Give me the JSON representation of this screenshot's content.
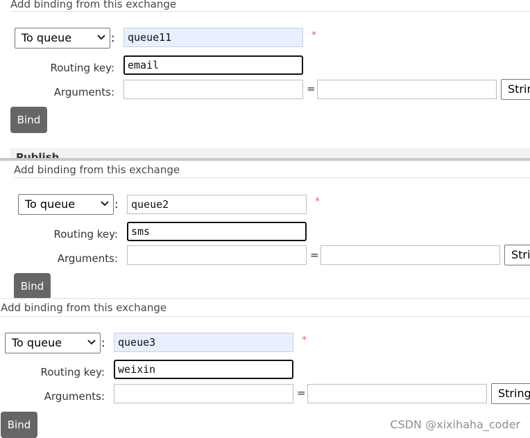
{
  "panels": [
    {
      "heading": "Add binding from this exchange",
      "destination_type": "To queue",
      "destination_value": "queue11",
      "required_marker": "*",
      "routing_key_label": "Routing key:",
      "routing_key_value": "email",
      "arguments_label": "Arguments:",
      "arguments_separator": "=",
      "argument_type": "String",
      "bind_label": "Bind",
      "next_section_label": "Publish"
    },
    {
      "heading": "Add binding from this exchange",
      "destination_type": "To queue",
      "destination_value": "queue2",
      "required_marker": "*",
      "routing_key_label": "Routing key:",
      "routing_key_value": "sms",
      "arguments_label": "Arguments:",
      "arguments_separator": "=",
      "argument_type": "String",
      "bind_label": "Bind"
    },
    {
      "heading": "Add binding from this exchange",
      "destination_type": "To queue",
      "destination_value": "queue3",
      "required_marker": "*",
      "routing_key_label": "Routing key:",
      "routing_key_value": "weixin",
      "arguments_label": "Arguments:",
      "arguments_separator": "=",
      "argument_type": "String",
      "bind_label": "Bind"
    }
  ],
  "watermark": "CSDN @xixihaha_coder",
  "colors": {
    "bind_button": "#666666",
    "required_marker": "#f15d5d",
    "autofill_background": "#e8f0fe"
  },
  "icons": {
    "select_arrow": "chevron-down-icon"
  }
}
